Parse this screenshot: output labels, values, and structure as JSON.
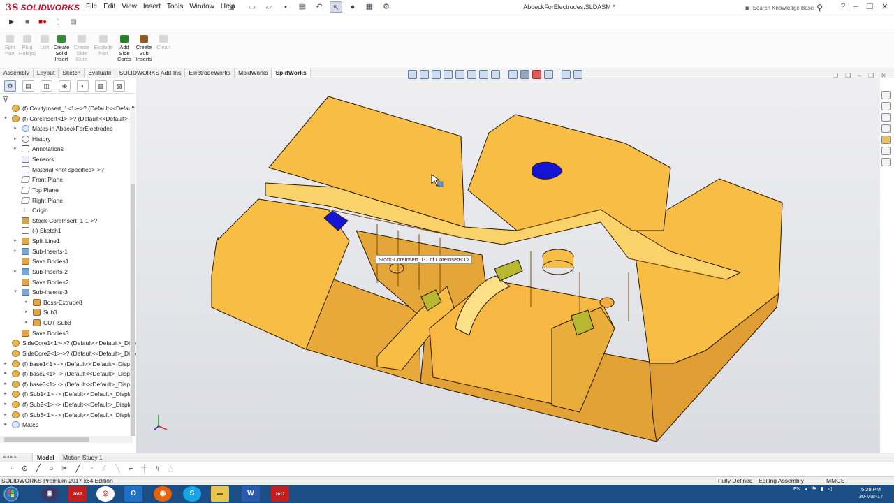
{
  "app": {
    "logo_prefix": "3S",
    "logo_name": "SOLIDWORKS",
    "document_title": "AbdeckForElectrodes.SLDASM *",
    "search_placeholder": "Search Knowledge Base"
  },
  "menu": [
    "File",
    "Edit",
    "View",
    "Insert",
    "Tools",
    "Window",
    "Help"
  ],
  "command_manager": [
    {
      "label": "Split Part",
      "enabled": false
    },
    {
      "label": "Plug Hole(s)",
      "enabled": false
    },
    {
      "label": "Loft",
      "enabled": false
    },
    {
      "label": "Create Solid Insert",
      "enabled": true
    },
    {
      "label": "Create Side Core",
      "enabled": false
    },
    {
      "label": "Explode Part",
      "enabled": false
    },
    {
      "label": "Add Side Cores",
      "enabled": true
    },
    {
      "label": "Create Sub Inserts",
      "enabled": true
    },
    {
      "label": "Clean",
      "enabled": false
    }
  ],
  "tabs": [
    "Assembly",
    "Layout",
    "Sketch",
    "Evaluate",
    "SOLIDWORKS Add-Ins",
    "ElectrodeWorks",
    "MoldWorks",
    "SplitWorks"
  ],
  "active_tab": "SplitWorks",
  "tree": [
    {
      "label": "(f) CavityInsert_1<1>->? (Default<<Default",
      "indent": 0,
      "expand": "",
      "icon": "asm"
    },
    {
      "label": "(f) CoreInsert<1>->? (Default<<Default>_D",
      "indent": 0,
      "expand": "▾",
      "icon": "asm"
    },
    {
      "label": "Mates in AbdeckForElectrodes",
      "indent": 1,
      "expand": "▸",
      "icon": "mates"
    },
    {
      "label": "History",
      "indent": 1,
      "expand": "▸",
      "icon": "hist"
    },
    {
      "label": "Annotations",
      "indent": 1,
      "expand": "▸",
      "icon": "ann"
    },
    {
      "label": "Sensors",
      "indent": 1,
      "expand": "",
      "icon": "sens"
    },
    {
      "label": "Material <not specified>->?",
      "indent": 1,
      "expand": "",
      "icon": "mat"
    },
    {
      "label": "Front Plane",
      "indent": 1,
      "expand": "",
      "icon": "plane"
    },
    {
      "label": "Top Plane",
      "indent": 1,
      "expand": "",
      "icon": "plane"
    },
    {
      "label": "Right Plane",
      "indent": 1,
      "expand": "",
      "icon": "plane"
    },
    {
      "label": "Origin",
      "indent": 1,
      "expand": "",
      "icon": "orig"
    },
    {
      "label": "Stock-CoreInsert_1-1->?",
      "indent": 1,
      "expand": "",
      "icon": "part"
    },
    {
      "label": "(-) Sketch1",
      "indent": 1,
      "expand": "",
      "icon": "sk"
    },
    {
      "label": "Split Line1",
      "indent": 1,
      "expand": "▸",
      "icon": "feat"
    },
    {
      "label": "Sub-Inserts-1",
      "indent": 1,
      "expand": "▸",
      "icon": "fold"
    },
    {
      "label": "Save Bodies1",
      "indent": 1,
      "expand": "",
      "icon": "feat"
    },
    {
      "label": "Sub-Inserts-2",
      "indent": 1,
      "expand": "▸",
      "icon": "fold"
    },
    {
      "label": "Save Bodies2",
      "indent": 1,
      "expand": "",
      "icon": "feat"
    },
    {
      "label": "Sub-Inserts-3",
      "indent": 1,
      "expand": "▾",
      "icon": "fold"
    },
    {
      "label": "Boss-Extrude8",
      "indent": 2,
      "expand": "▸",
      "icon": "feat"
    },
    {
      "label": "Sub3",
      "indent": 2,
      "expand": "▸",
      "icon": "feat"
    },
    {
      "label": "CUT-Sub3",
      "indent": 2,
      "expand": "▸",
      "icon": "feat"
    },
    {
      "label": "Save Bodies3",
      "indent": 1,
      "expand": "",
      "icon": "feat"
    },
    {
      "label": "SideCore1<1>->? (Default<<Default>_Disp",
      "indent": 0,
      "expand": "",
      "icon": "asm"
    },
    {
      "label": "SideCore2<1>->? (Default<<Default>_Disp",
      "indent": 0,
      "expand": "",
      "icon": "asm"
    },
    {
      "label": "(f) base1<1> -> (Default<<Default>_Displa",
      "indent": 0,
      "expand": "▸",
      "icon": "asm"
    },
    {
      "label": "(f) base2<1> -> (Default<<Default>_Displa",
      "indent": 0,
      "expand": "▸",
      "icon": "asm"
    },
    {
      "label": "(f) base3<1> -> (Default<<Default>_Displa",
      "indent": 0,
      "expand": "▸",
      "icon": "asm"
    },
    {
      "label": "(f) Sub1<1> -> (Default<<Default>_Display",
      "indent": 0,
      "expand": "▸",
      "icon": "asm"
    },
    {
      "label": "(f) Sub2<1> -> (Default<<Default>_Display",
      "indent": 0,
      "expand": "▸",
      "icon": "asm"
    },
    {
      "label": "(f) Sub3<1> -> (Default<<Default>_Display",
      "indent": 0,
      "expand": "▸",
      "icon": "asm"
    },
    {
      "label": "Mates",
      "indent": 0,
      "expand": "▸",
      "icon": "mates"
    }
  ],
  "viewport": {
    "tooltip": "Stock-CoreInsert_1-1 of CoreInsert<1>",
    "model_color": "#f7bd45",
    "highlight_blue": "#1414d2",
    "highlight_green": "#b8b830"
  },
  "bottom_tabs": {
    "model": "Model",
    "motion": "Motion Study 1"
  },
  "status": {
    "edition": "SOLIDWORKS Premium 2017 x64 Edition",
    "definition": "Fully Defined",
    "mode": "Editing Assembly",
    "units": "MMGS"
  },
  "taskbar": {
    "lang": "EN",
    "time": "5:28 PM",
    "date": "30-Mar-17",
    "sw_badge": "2017"
  }
}
